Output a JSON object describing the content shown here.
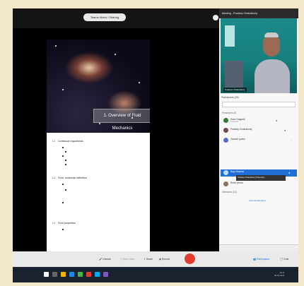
{
  "topbar": {
    "share_label": "Teams Video / Sharing"
  },
  "slide": {
    "title": "1. Overview of Fluid Mechanics"
  },
  "doc": {
    "sections": [
      {
        "num": "1.1",
        "heading": "Continuum hypothesis"
      },
      {
        "num": "1.2",
        "heading": "Fluid: molecular definition"
      },
      {
        "num": "1.3",
        "heading": "Fluid properties"
      }
    ]
  },
  "panel": {
    "header": "Meeting - Pradeep Chakraborty",
    "video_name": "Pradeep Chakraborty",
    "participants_label": "Participants (29)",
    "group_presenters": "Presenters (5)",
    "group_attendees": "Attendees (23)",
    "selected_tooltip": "Pradeep Chakraborty (Presenter)",
    "more_link": "View all attendees",
    "chat_label": "Chat",
    "people": [
      {
        "name": "Sara Chaganti",
        "sub": "Presenter"
      },
      {
        "name": "Pradeep Chakraborty",
        "sub": ""
      },
      {
        "name": "Ganesh guntur",
        "sub": ""
      },
      {
        "name": "Raju Sharma",
        "sub": ""
      },
      {
        "name": "Rohit Verma",
        "sub": ""
      }
    ]
  },
  "controls": {
    "unmute": "Unmute",
    "start_video": "Start video",
    "share": "Share",
    "record": "Record",
    "participants": "Participants",
    "chat": "Chat"
  },
  "taskbar": {
    "time": "10:14",
    "date": "04-03-2021"
  }
}
